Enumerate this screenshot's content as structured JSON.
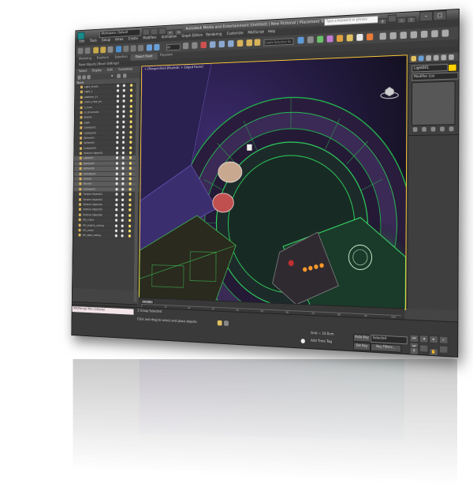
{
  "window": {
    "title": "Autodesk Media and Entertainment (Untitled) | New Fictional  |  Placement Tool.max",
    "workspace": "Workspace: Default",
    "search_placeholder": "Type a keyword or phrase",
    "controls": [
      "–",
      "□",
      "✕"
    ]
  },
  "menus": [
    "Edit",
    "Tools",
    "Group",
    "Views",
    "Create",
    "Modifiers",
    "Animation",
    "Graph Editors",
    "Rendering",
    "Customize",
    "MAXScript",
    "Help"
  ],
  "toolbar": {
    "select_filter": "All",
    "selection_set": "Create Selection Se"
  },
  "ribbon": {
    "tabs": [
      "Modeling",
      "Freeform",
      "Selection",
      "Object Paint",
      "Populate"
    ],
    "active_tab": "Object Paint",
    "sub_label": "Paint Objects  [Brush Settings]"
  },
  "scene_explorer": {
    "tabs": [
      "Select",
      "Display",
      "Edit",
      "Customize"
    ],
    "column_name": "Name",
    "rows": [
      {
        "name": "Light_Shafts",
        "sel": false
      },
      {
        "name": "Light_1",
        "sel": false
      },
      {
        "name": "platform_01",
        "sel": false
      },
      {
        "name": "chain_crate_sm",
        "sel": false
      },
      {
        "name": "C_Core",
        "sel": false
      },
      {
        "name": "cr_structures",
        "sel": false
      },
      {
        "name": "Engine",
        "sel": false
      },
      {
        "name": "Light",
        "sel": false
      },
      {
        "name": "Cylinder01",
        "sel": false
      },
      {
        "name": "Cylinder02",
        "sel": false
      },
      {
        "name": "Sphere01",
        "sel": false
      },
      {
        "name": "Sphere02",
        "sel": false
      },
      {
        "name": "Cylinder03",
        "sel": false
      },
      {
        "name": "Turbine Object01",
        "sel": false
      },
      {
        "name": "Light001",
        "sel": true
      },
      {
        "name": "Sphere03",
        "sel": true
      },
      {
        "name": "Sphere04",
        "sel": true
      },
      {
        "name": "Cylinder04",
        "sel": true
      },
      {
        "name": "Cone01",
        "sel": true
      },
      {
        "name": "Torus01",
        "sel": true
      },
      {
        "name": "Cylinder05",
        "sel": true
      },
      {
        "name": "Turbine Object02",
        "sel": false
      },
      {
        "name": "Turbine Object03",
        "sel": false
      },
      {
        "name": "Turbine Object04",
        "sel": false
      },
      {
        "name": "Turbine Object05",
        "sel": false
      },
      {
        "name": "Turbine Object06",
        "sel": false
      },
      {
        "name": "dm_crane",
        "sel": false
      },
      {
        "name": "dm_engine_casing",
        "sel": false
      },
      {
        "name": "dm_cover",
        "sel": false
      },
      {
        "name": "dm_pipe_casing",
        "sel": false
      }
    ],
    "layer_manager": "Layer Manager"
  },
  "viewport": {
    "label": "+ [Perspective] [Realistic + Edged Faces]"
  },
  "command_panel": {
    "object_name": "Light001",
    "modifier_list": "Modifier List",
    "swatch_color": "#ffd200"
  },
  "timeline": {
    "frame_label": "0 / 100",
    "ticks": [
      "0",
      "10",
      "20",
      "30",
      "40",
      "50",
      "60",
      "70",
      "80",
      "90",
      "100"
    ]
  },
  "status": {
    "maxscript": "MAXScript Mini Listener",
    "line1": "1 Group Selected",
    "line2": "Click and drag to select and place objects",
    "grid": "Grid = 10.0cm",
    "add_time_tag": "Add Time Tag",
    "auto_key": "Auto Key",
    "selected": "Selected",
    "set_key": "Set Key",
    "key_filters": "Key Filters..."
  }
}
